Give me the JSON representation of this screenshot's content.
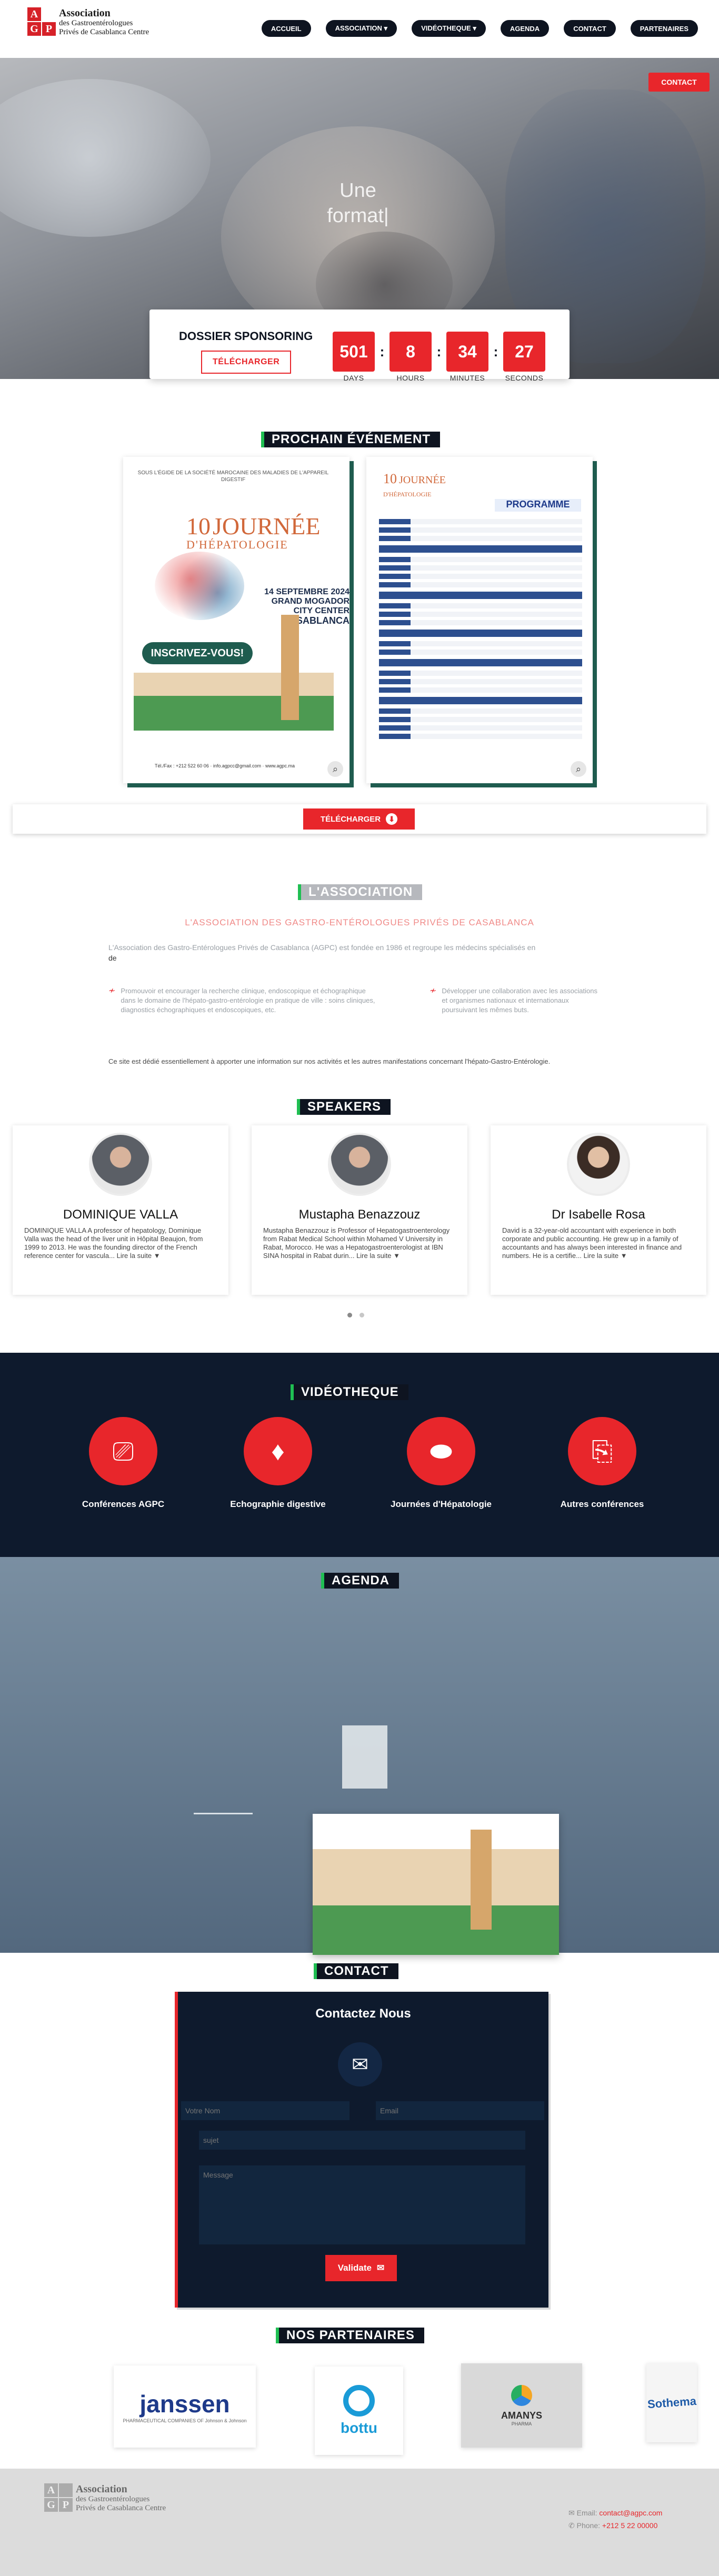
{
  "header": {
    "logo": {
      "letters": [
        "A",
        "G",
        "P",
        "C"
      ],
      "line1": "Association",
      "line2": "des Gastroentérologues",
      "line3": "Privés de Casablanca Centre"
    },
    "nav": [
      "ACCUEIL",
      "ASSOCIATION ▾",
      "VIDÉOTHEQUE ▾",
      "AGENDA",
      "CONTACT",
      "PARTENAIRES"
    ]
  },
  "hero": {
    "contact_button": "CONTACT",
    "title_line1": "Une",
    "title_line2": "format|"
  },
  "countdown": {
    "title": "DOSSIER SPONSORING",
    "download_label": "TÉLÉCHARGER",
    "units": [
      {
        "value": "501",
        "label": "DAYS"
      },
      {
        "value": "8",
        "label": "HOURS"
      },
      {
        "value": "34",
        "label": "MINUTES"
      },
      {
        "value": "27",
        "label": "SECONDS"
      }
    ]
  },
  "event": {
    "heading": "PROCHAIN ÉVÉNEMENT",
    "poster1": {
      "header": "SOUS L'ÉGIDE DE LA SOCIÉTÉ MAROCAINE DES MALADIES DE L'APPAREIL DIGESTIF",
      "edition": "10",
      "title": "JOURNÉE",
      "subtitle": "D'HÉPATOLOGIE",
      "date": "14 SEPTEMBRE 2024",
      "venue": "GRAND MOGADOR CITY CENTER",
      "city": "CASABLANCA",
      "cta": "INSCRIVEZ-VOUS!",
      "footer": "Tél./Fax : +212 522 60 06 · info.agpcc@gmail.com · www.agpc.ma"
    },
    "poster2": {
      "edition": "10",
      "title": "JOURNÉE",
      "subtitle": "D'HÉPATOLOGIE",
      "program_title": "PROGRAMME"
    },
    "download_label": "TÉLÉCHARGER"
  },
  "association": {
    "heading": "L'ASSOCIATION",
    "subtitle": "L'ASSOCIATION DES GASTRO-ENTÉROLOGUES PRIVÉS DE CASABLANCA",
    "intro": "L'Association des Gastro-Entérologues Privés de Casablanca (AGPC) est fondée en 1986 et regroupe les médecins spécialisés en",
    "intro_tail": "de",
    "bullet1": "Promouvoir et encourager la recherche clinique, endoscopique et échographique dans le domaine de l'hépato-gastro-entérologie en pratique de ville : soins cliniques, diagnostics échographiques et endoscopiques, etc.",
    "bullet2": "Développer une collaboration avec les associations et organismes nationaux et internationaux poursuivant les mêmes buts.",
    "body": "Ce site est dédié essentiellement à apporter une information sur nos activités et les autres manifestations concernant l'hépato-Gastro-Entérologie."
  },
  "speakers": {
    "heading": "SPEAKERS",
    "items": [
      {
        "name": "DOMINIQUE VALLA",
        "bio": "DOMINIQUE VALLA A professor of hepatology, Dominique Valla was the head of the liver unit in Hôpital Beaujon, from 1999 to 2013. He was the founding director of the French reference center for vascula...",
        "more": "Lire la suite ▼"
      },
      {
        "name": "Mustapha Benazzouz",
        "bio": "Mustapha Benazzouz is Professor of Hepatogastroenterology from Rabat Medical School within Mohamed V University in Rabat, Morocco. He was a Hepatogastroenterologist at IBN SINA hospital in Rabat durin...",
        "more": "Lire la suite ▼"
      },
      {
        "name": "Dr Isabelle Rosa",
        "bio": "David is a 32-year-old accountant with experience in both corporate and public accounting. He grew up in a family of accountants and has always been interested in finance and numbers. He is a certifie...",
        "more": "Lire la suite ▼"
      }
    ]
  },
  "videotheque": {
    "heading": "VIDÉOTHEQUE",
    "items": [
      {
        "label": "Conférences AGPC",
        "icon": "presentation-icon"
      },
      {
        "label": "Echographie digestive",
        "icon": "ultrasound-probe-icon"
      },
      {
        "label": "Journées d'Hépatologie",
        "icon": "liver-icon"
      },
      {
        "label": "Autres conférences",
        "icon": "speaker-board-icon"
      }
    ]
  },
  "agenda": {
    "heading": "AGENDA"
  },
  "contact": {
    "heading": "CONTACT",
    "title": "Contactez Nous",
    "name_placeholder": "Votre Nom",
    "email_placeholder": "Email",
    "subject_placeholder": "sujet",
    "message_placeholder": "Message",
    "submit": "Validate"
  },
  "partners": {
    "heading": "NOS PARTENAIRES",
    "items": [
      "janssen",
      "PHARMACEUTICAL COMPANIES OF Johnson & Johnson",
      "bottu",
      "AMANYS",
      "PHARMA",
      "Sothema"
    ]
  },
  "footer": {
    "email_label": "Email:",
    "email": "contact@agpc.com",
    "phone_label": "Phone:",
    "phone": "+212 5 22 00000"
  },
  "colors": {
    "accent": "#e8262b",
    "dark": "#0e1420",
    "green": "#1fbf52"
  }
}
